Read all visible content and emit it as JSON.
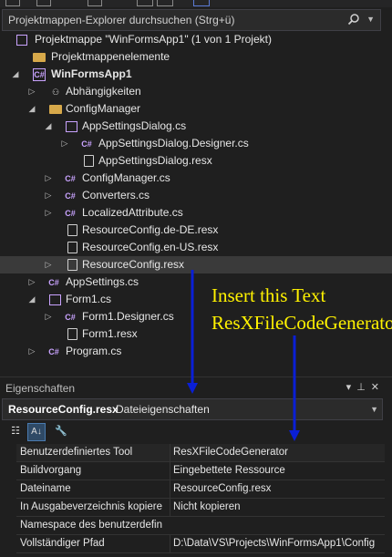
{
  "search": {
    "placeholder": "Projektmappen-Explorer durchsuchen (Strg+ü)"
  },
  "tree": {
    "solution": "Projektmappe \"WinFormsApp1\" (1 von 1 Projekt)",
    "items": [
      {
        "label": "Projektmappenelemente",
        "icon": "folder-icon"
      },
      {
        "label": "WinFormsApp1",
        "icon": "csharp-project-icon"
      },
      {
        "label": "Abhängigkeiten",
        "icon": "dependencies-icon"
      },
      {
        "label": "ConfigManager",
        "icon": "folder-icon"
      },
      {
        "label": "AppSettingsDialog.cs",
        "icon": "form-icon"
      },
      {
        "label": "AppSettingsDialog.Designer.cs",
        "icon": "csharp-file-icon"
      },
      {
        "label": "AppSettingsDialog.resx",
        "icon": "resx-file-icon"
      },
      {
        "label": "ConfigManager.cs",
        "icon": "csharp-file-icon"
      },
      {
        "label": "Converters.cs",
        "icon": "csharp-file-icon"
      },
      {
        "label": "LocalizedAttribute.cs",
        "icon": "csharp-file-icon"
      },
      {
        "label": "ResourceConfig.de-DE.resx",
        "icon": "resx-file-icon"
      },
      {
        "label": "ResourceConfig.en-US.resx",
        "icon": "resx-file-icon"
      },
      {
        "label": "ResourceConfig.resx",
        "icon": "resx-file-icon"
      },
      {
        "label": "AppSettings.cs",
        "icon": "csharp-file-icon"
      },
      {
        "label": "Form1.cs",
        "icon": "form-icon"
      },
      {
        "label": "Form1.Designer.cs",
        "icon": "csharp-file-icon"
      },
      {
        "label": "Form1.resx",
        "icon": "resx-file-icon"
      },
      {
        "label": "Program.cs",
        "icon": "csharp-file-icon"
      }
    ]
  },
  "annotation": {
    "line1": "Insert this Text",
    "line2": "ResXFileCodeGenerator"
  },
  "properties": {
    "title": "Eigenschaften",
    "object_name": "ResourceConfig.resx",
    "object_type": "Dateieigenschaften",
    "rows": [
      {
        "name": "Benutzerdefiniertes Tool",
        "value": "ResXFileCodeGenerator"
      },
      {
        "name": "Buildvorgang",
        "value": "Eingebettete Ressource"
      },
      {
        "name": "Dateiname",
        "value": "ResourceConfig.resx"
      },
      {
        "name": "In Ausgabeverzeichnis kopiere",
        "value": "Nicht kopieren"
      },
      {
        "name": "Namespace des benutzerdefin",
        "value": ""
      },
      {
        "name": "Vollständiger Pfad",
        "value": "D:\\Data\\VS\\Projects\\WinFormsApp1\\Config"
      }
    ]
  },
  "colors": {
    "accent": "#c9a3ff",
    "annotation": "#fff200",
    "arrow": "#0a1fd6",
    "selection": "#3a3a3a"
  }
}
